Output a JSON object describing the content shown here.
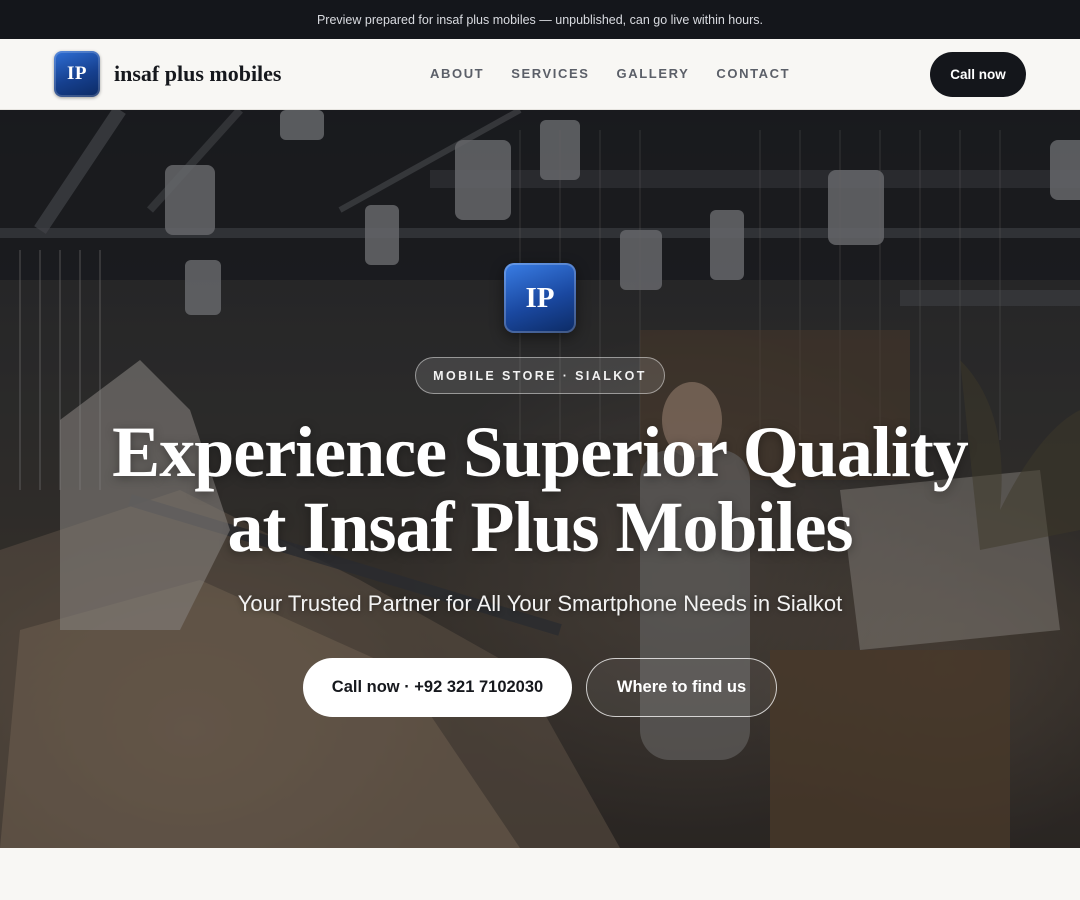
{
  "preview_banner": {
    "text": "Preview prepared for insaf plus mobiles — unpublished, can go live within hours."
  },
  "header": {
    "logo_text": "IP",
    "brand_name": "insaf plus mobiles",
    "nav": [
      {
        "label": "ABOUT"
      },
      {
        "label": "SERVICES"
      },
      {
        "label": "GALLERY"
      },
      {
        "label": "CONTACT"
      }
    ],
    "cta_label": "Call now"
  },
  "hero": {
    "logo_text": "IP",
    "eyebrow": "MOBILE STORE · SIALKOT",
    "title_line1": "Experience Superior Quality",
    "title_line2": "at Insaf Plus Mobiles",
    "subtitle": "Your Trusted Partner for All Your Smartphone Needs in Sialkot",
    "primary_button": "Call now · +92 321 7102030",
    "secondary_button": "Where to find us"
  },
  "colors": {
    "banner_bg": "#14161b",
    "page_bg": "#f8f7f4",
    "logo_blue": "#1a48a0",
    "cta_dark": "#14161b"
  }
}
